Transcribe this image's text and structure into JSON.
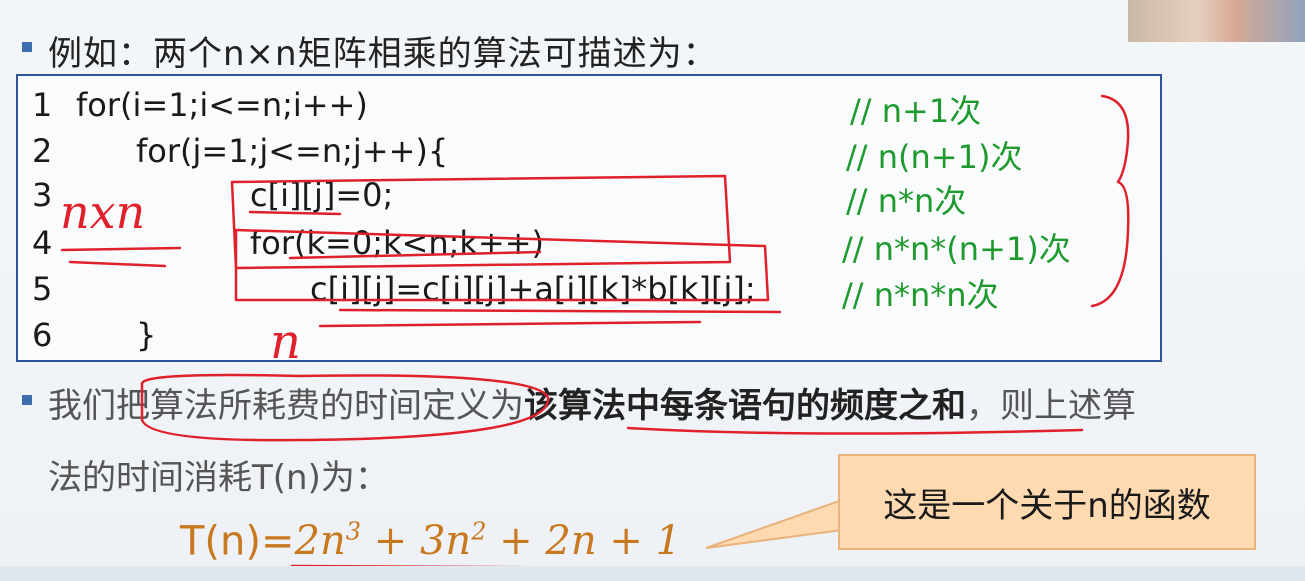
{
  "heading": "例如：两个n×n矩阵相乘的算法可描述为：",
  "code_lines": [
    {
      "num": "1",
      "code": "for(i=1;i<=n;i++)",
      "comment": "// n+1次"
    },
    {
      "num": "2",
      "code": "for(j=1;j<=n;j++){",
      "comment": "// n(n+1)次"
    },
    {
      "num": "3",
      "code": "c[i][j]=0;",
      "comment": "// n*n次"
    },
    {
      "num": "4",
      "code": "for(k=0;k<n;k++)",
      "comment": "// n*n*(n+1)次"
    },
    {
      "num": "5",
      "code": "c[i][j]=c[i][j]+a[i][k]*b[k][j];",
      "comment": "// n*n*n次"
    },
    {
      "num": "6",
      "code": "}",
      "comment": ""
    }
  ],
  "paragraph1": {
    "prefix": "我们把算法所耗费的时间定义为",
    "bold": "该算法中每条语句的频度之和",
    "suffix": "，则上述算"
  },
  "paragraph2": "法的时间消耗T(n)为：",
  "formula": {
    "lhs": "T(n)=",
    "rhs_html_parts": [
      "2",
      "n",
      "3",
      " + 3",
      "n",
      "2",
      " + 2",
      "n",
      " + 1"
    ]
  },
  "callout": "这是一个关于n的函数",
  "handwritten": {
    "nxn": "nxn",
    "n": "n"
  },
  "colors": {
    "border": "#2f5597",
    "comment": "#1e9a2e",
    "formula": "#c8781f",
    "annotation": "#e0202a",
    "callout_bg": "#ffd9b0"
  }
}
